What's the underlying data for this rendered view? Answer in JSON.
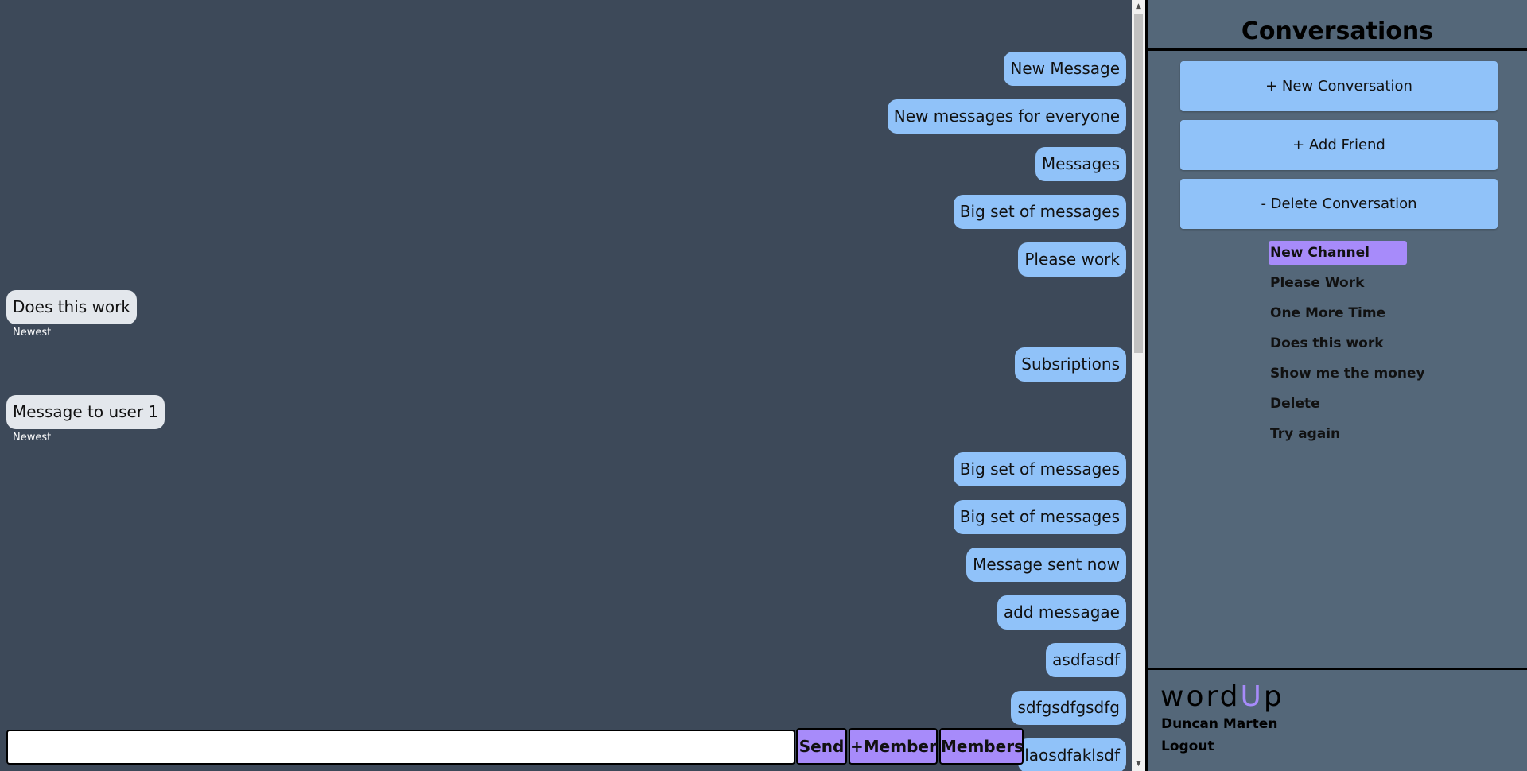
{
  "colors": {
    "chat_background": "#3d4959",
    "sidebar_background": "#546779",
    "outgoing_bubble": "#90c2f9",
    "incoming_bubble": "#e3e7ec",
    "accent_purple": "#a78bfa"
  },
  "chat": {
    "messages": [
      {
        "text": "New Message",
        "side": "out"
      },
      {
        "text": "New messages for everyone",
        "side": "out"
      },
      {
        "text": "Messages",
        "side": "out"
      },
      {
        "text": "Big set of messages",
        "side": "out"
      },
      {
        "text": "Please work",
        "side": "out"
      },
      {
        "text": "Does this work",
        "side": "in",
        "caption": "Newest"
      },
      {
        "text": "Subsriptions",
        "side": "out"
      },
      {
        "text": "Message to user 1",
        "side": "in",
        "caption": "Newest"
      },
      {
        "text": "Big set of messages",
        "side": "out"
      },
      {
        "text": "Big set of messages",
        "side": "out"
      },
      {
        "text": "Message sent now",
        "side": "out"
      },
      {
        "text": "add messagae",
        "side": "out"
      },
      {
        "text": "asdfasdf",
        "side": "out"
      },
      {
        "text": "sdfgsdfgsdfg",
        "side": "out"
      },
      {
        "text": "laosdfaklsdf",
        "side": "out"
      }
    ],
    "input": {
      "value": "",
      "placeholder": ""
    },
    "send_label": "Send",
    "add_member_label": "+Member",
    "members_label": "Members"
  },
  "sidebar": {
    "title": "Conversations",
    "new_conversation_label": "+ New Conversation",
    "add_friend_label": "+ Add Friend",
    "delete_conversation_label": "- Delete Conversation",
    "conversations": [
      {
        "label": "New Channel",
        "active": true
      },
      {
        "label": "Please Work",
        "active": false
      },
      {
        "label": "One More Time",
        "active": false
      },
      {
        "label": "Does this work",
        "active": false
      },
      {
        "label": "Show me the money",
        "active": false
      },
      {
        "label": "Delete",
        "active": false
      },
      {
        "label": "Try again",
        "active": false
      }
    ],
    "logo": {
      "part1": "word",
      "part2": "U",
      "part3": "p"
    },
    "username": "Duncan Marten",
    "logout_label": "Logout"
  }
}
